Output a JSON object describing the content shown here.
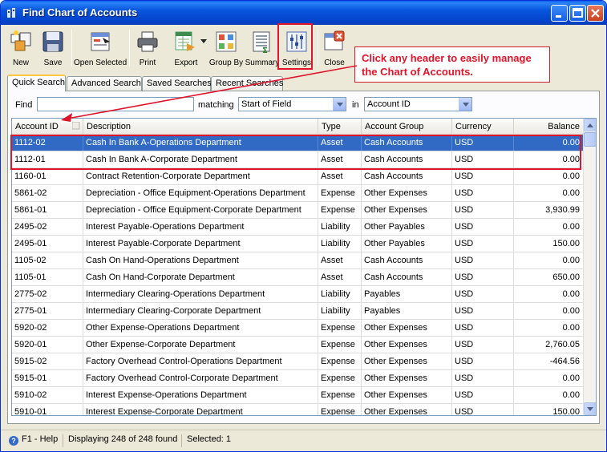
{
  "window": {
    "title": "Find Chart of Accounts"
  },
  "toolbar": {
    "new": "New",
    "save": "Save",
    "open_selected": "Open Selected",
    "print": "Print",
    "export": "Export",
    "group_by": "Group By",
    "summary": "Summary",
    "settings": "Settings",
    "close": "Close"
  },
  "callout": {
    "text": "Click any header to easily manage the Chart of Accounts."
  },
  "tabs": [
    "Quick Search",
    "Advanced Search",
    "Saved Searches",
    "Recent Searches"
  ],
  "search": {
    "find_label": "Find",
    "find_value": "",
    "matching_label": "matching",
    "matching_value": "Start of Field",
    "in_label": "in",
    "in_value": "Account ID"
  },
  "columns": [
    "Account ID",
    "Description",
    "Type",
    "Account Group",
    "Currency",
    "Balance"
  ],
  "rows": [
    [
      "1112-02",
      "Cash In Bank A-Operations Department",
      "Asset",
      "Cash Accounts",
      "USD",
      "0.00"
    ],
    [
      "1112-01",
      "Cash In Bank A-Corporate Department",
      "Asset",
      "Cash Accounts",
      "USD",
      "0.00"
    ],
    [
      "1160-01",
      "Contract Retention-Corporate Department",
      "Asset",
      "Cash Accounts",
      "USD",
      "0.00"
    ],
    [
      "5861-02",
      "Depreciation - Office Equipment-Operations Department",
      "Expense",
      "Other Expenses",
      "USD",
      "0.00"
    ],
    [
      "5861-01",
      "Depreciation - Office Equipment-Corporate Department",
      "Expense",
      "Other Expenses",
      "USD",
      "3,930.99"
    ],
    [
      "2495-02",
      "Interest Payable-Operations Department",
      "Liability",
      "Other Payables",
      "USD",
      "0.00"
    ],
    [
      "2495-01",
      "Interest Payable-Corporate Department",
      "Liability",
      "Other Payables",
      "USD",
      "150.00"
    ],
    [
      "1105-02",
      "Cash On Hand-Operations Department",
      "Asset",
      "Cash Accounts",
      "USD",
      "0.00"
    ],
    [
      "1105-01",
      "Cash On Hand-Corporate Department",
      "Asset",
      "Cash Accounts",
      "USD",
      "650.00"
    ],
    [
      "2775-02",
      "Intermediary Clearing-Operations Department",
      "Liability",
      "Payables",
      "USD",
      "0.00"
    ],
    [
      "2775-01",
      "Intermediary Clearing-Corporate Department",
      "Liability",
      "Payables",
      "USD",
      "0.00"
    ],
    [
      "5920-02",
      "Other Expense-Operations Department",
      "Expense",
      "Other Expenses",
      "USD",
      "0.00"
    ],
    [
      "5920-01",
      "Other Expense-Corporate Department",
      "Expense",
      "Other Expenses",
      "USD",
      "2,760.05"
    ],
    [
      "5915-02",
      "Factory Overhead Control-Operations Department",
      "Expense",
      "Other Expenses",
      "USD",
      "-464.56"
    ],
    [
      "5915-01",
      "Factory Overhead Control-Corporate Department",
      "Expense",
      "Other Expenses",
      "USD",
      "0.00"
    ],
    [
      "5910-02",
      "Interest Expense-Operations Department",
      "Expense",
      "Other Expenses",
      "USD",
      "0.00"
    ],
    [
      "5910-01",
      "Interest Expense-Corporate Department",
      "Expense",
      "Other Expenses",
      "USD",
      "150.00"
    ]
  ],
  "selected_row": 0,
  "status": {
    "help": "F1 - Help",
    "displaying": "Displaying 248 of 248 found",
    "selected": "Selected: 1"
  }
}
